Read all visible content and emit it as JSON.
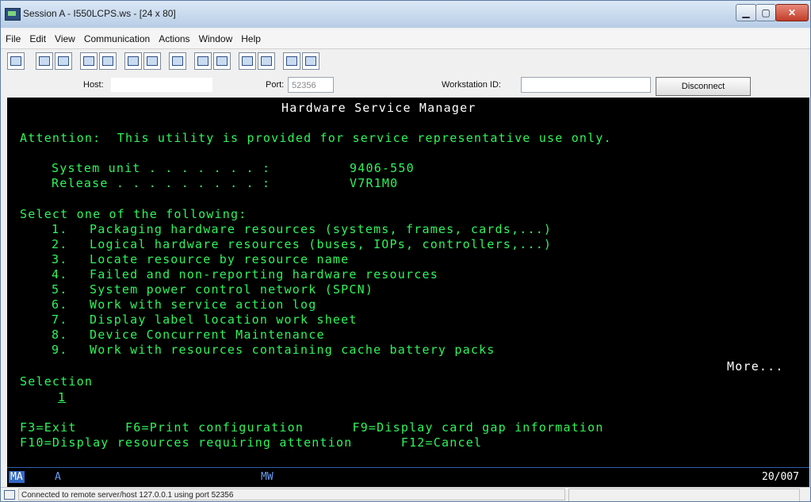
{
  "window": {
    "title": "Session A - I550LCPS.ws - [24 x 80]"
  },
  "menu": [
    "File",
    "Edit",
    "View",
    "Communication",
    "Actions",
    "Window",
    "Help"
  ],
  "toolbar": {
    "icons": [
      "print-screen",
      "copy",
      "paste",
      "send",
      "receive",
      "display",
      "keypad",
      "macro-record",
      "macro-play",
      "macro-stop",
      "macro-edit",
      "transfer-send",
      "transfer-receive",
      "color-map",
      "customize"
    ]
  },
  "hostbar": {
    "host_label": "Host:",
    "port_label": "Port:",
    "port_value": "52356",
    "workstation_label": "Workstation ID:",
    "workstation_value": "",
    "disconnect_label": "Disconnect"
  },
  "screen": {
    "title": "Hardware Service Manager",
    "attention": "Attention:  This utility is provided for service representative use only.",
    "system_unit_label": "System unit . . . . . . . :",
    "system_unit_value": "9406-550",
    "release_label": "Release . . . . . . . . . :",
    "release_value": "V7R1M0",
    "select_prompt": "Select one of the following:",
    "options": [
      {
        "num": "1.",
        "text": "Packaging hardware resources (systems, frames, cards,...)"
      },
      {
        "num": "2.",
        "text": "Logical hardware resources (buses, IOPs, controllers,...)"
      },
      {
        "num": "3.",
        "text": "Locate resource by resource name"
      },
      {
        "num": "4.",
        "text": "Failed and non-reporting hardware resources"
      },
      {
        "num": "5.",
        "text": "System power control network (SPCN)"
      },
      {
        "num": "6.",
        "text": "Work with service action log"
      },
      {
        "num": "7.",
        "text": "Display label location work sheet"
      },
      {
        "num": "8.",
        "text": "Device Concurrent Maintenance"
      },
      {
        "num": "9.",
        "text": "Work with resources containing cache battery packs"
      }
    ],
    "more": "More...",
    "selection_label": "Selection",
    "selection_value": "1",
    "fkeys_line1": "F3=Exit      F6=Print configuration      F9=Display card gap information",
    "fkeys_line2": "F10=Display resources requiring attention      F12=Cancel"
  },
  "oia": {
    "ma": "MA",
    "a": "A",
    "mw": "MW",
    "cursor": "20/007"
  },
  "status": {
    "text": "Connected to remote server/host 127.0.0.1 using port 52356"
  }
}
